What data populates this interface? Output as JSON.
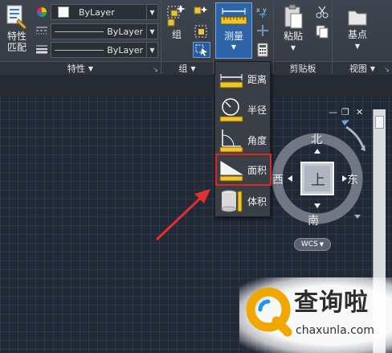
{
  "ribbon": {
    "properties_panel": {
      "match_button_label": "特性\n匹配",
      "color_value": "ByLayer",
      "linetype_value": "ByLayer",
      "lineweight_value": "ByLayer",
      "title": "特性"
    },
    "group_panel": {
      "group_button_label": "组",
      "title": "组"
    },
    "utilities_panel": {
      "measure_button_label": "测量"
    },
    "clipboard_panel": {
      "paste_button_label": "粘贴",
      "title": "剪贴板"
    },
    "view_panel": {
      "base_button_label": "基点",
      "title": "视图"
    }
  },
  "measure_menu": {
    "items": [
      {
        "label": "距离",
        "icon": "distance-icon"
      },
      {
        "label": "半径",
        "icon": "radius-icon"
      },
      {
        "label": "角度",
        "icon": "angle-icon"
      },
      {
        "label": "面积",
        "icon": "area-icon"
      },
      {
        "label": "体积",
        "icon": "volume-icon"
      }
    ],
    "highlighted": "面积",
    "highlight_color": "#d9262a"
  },
  "viewcube": {
    "north": "北",
    "south": "南",
    "east": "东",
    "west": "西",
    "face": "上",
    "wcs_label": "WCS"
  },
  "watermark": {
    "title": "查询啦",
    "url": "chaxunla.com",
    "logo_color": "#f0a800"
  },
  "annotation": {
    "arrow_color": "#e03030"
  }
}
